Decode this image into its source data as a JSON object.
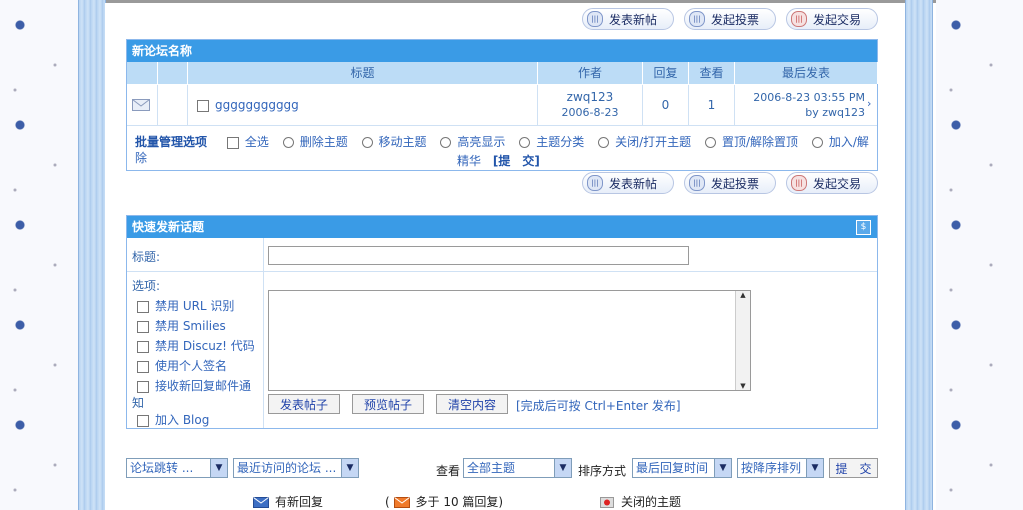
{
  "toolbar": {
    "new_post": "发表新帖",
    "poll": "发起投票",
    "trade": "发起交易"
  },
  "forum": {
    "title": "新论坛名称",
    "columns": [
      "标题",
      "作者",
      "回复",
      "查看",
      "最后发表"
    ],
    "thread": {
      "title": "ggggggggggg",
      "author": "zwq123",
      "date": "2006-8-23",
      "replies": "0",
      "views": "1",
      "last_time": "2006-8-23 03:55 PM",
      "last_by": "by zwq123"
    },
    "batch": {
      "label": "批量管理选项",
      "select_all": "全选",
      "options": [
        "删除主题",
        "移动主题",
        "高亮显示",
        "主题分类",
        "关闭/打开主题",
        "置顶/解除置顶",
        "加入/解除"
      ],
      "cont": "精华",
      "submit": "[提　交]"
    }
  },
  "quick_post": {
    "title": "快速发新话题",
    "subject_label": "标题:",
    "options_label": "选项:",
    "options": [
      "禁用 URL 识别",
      "禁用 Smilies",
      "禁用 Discuz! 代码",
      "使用个人签名",
      "接收新回复邮件通"
    ],
    "option_cont": "知",
    "blog": "加入 Blog",
    "post_btn": "发表帖子",
    "preview_btn": "预览帖子",
    "clear_btn": "清空内容",
    "hint": "[完成后可按 Ctrl+Enter 发布]"
  },
  "filters": {
    "jump": "论坛跳转 ...",
    "recent": "最近访问的论坛 ...",
    "view_label": "查看",
    "view_value": "全部主题",
    "sort_label": "排序方式",
    "sort_value": "最后回复时间",
    "order_value": "按降序排列",
    "submit": "提　交"
  },
  "legend": {
    "new_reply": "有新回复",
    "hot_open": "(",
    "hot": "多于 10 篇回复",
    "hot_close": ")",
    "closed": "关闭的主题"
  },
  "colors": {
    "header": "#3a9be6",
    "column_header": "#bcdcf6",
    "link": "#3366bb"
  }
}
